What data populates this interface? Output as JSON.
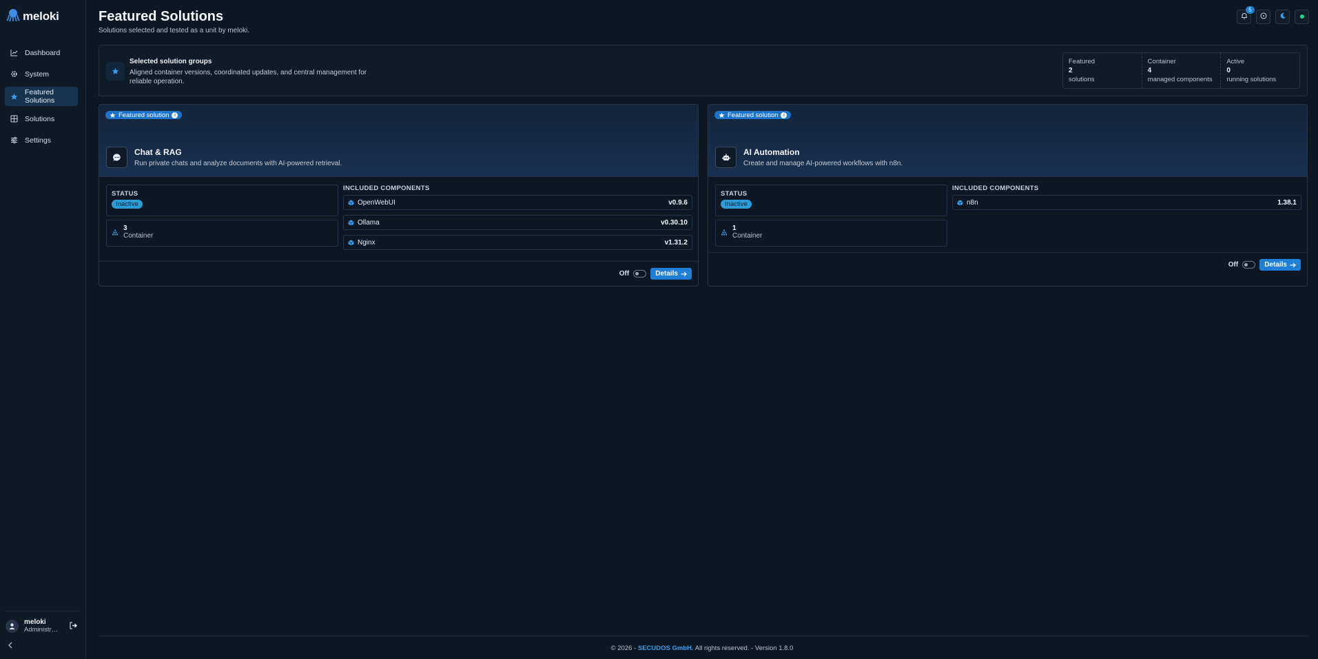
{
  "app": {
    "name": "meloki"
  },
  "sidebar": {
    "items": [
      {
        "label": "Dashboard",
        "icon": "chart-line-icon"
      },
      {
        "label": "System",
        "icon": "gear-icon"
      },
      {
        "label": "Featured Solutions",
        "icon": "star-icon",
        "active": true
      },
      {
        "label": "Solutions",
        "icon": "grid-icon"
      },
      {
        "label": "Settings",
        "icon": "sliders-icon"
      }
    ],
    "user": {
      "name": "meloki",
      "role": "Administr…"
    }
  },
  "header": {
    "title": "Featured Solutions",
    "subtitle": "Solutions selected and tested as a unit by meloki.",
    "notifications_count": "5"
  },
  "intro": {
    "title": "Selected solution groups",
    "description": "Aligned container versions, coordinated updates, and central management for reliable operation.",
    "stats": [
      {
        "label": "Featured",
        "value": "2",
        "sub": "solutions"
      },
      {
        "label": "Container",
        "value": "4",
        "sub": "managed components"
      },
      {
        "label": "Active",
        "value": "0",
        "sub": "running solutions"
      }
    ]
  },
  "solutions": [
    {
      "tag": "Featured solution",
      "title": "Chat & RAG",
      "description": "Run private chats and analyze documents with AI-powered retrieval.",
      "status_label": "STATUS",
      "status": "Inactive",
      "container_count": "3",
      "container_label": "Container",
      "components_label": "INCLUDED COMPONENTS",
      "components": [
        {
          "name": "OpenWebUI",
          "version": "v0.9.6"
        },
        {
          "name": "Ollama",
          "version": "v0.30.10"
        },
        {
          "name": "Nginx",
          "version": "v1.31.2"
        }
      ],
      "toggle_label": "Off",
      "details_label": "Details"
    },
    {
      "tag": "Featured solution",
      "title": "AI Automation",
      "description": "Create and manage AI-powered workflows with n8n.",
      "status_label": "STATUS",
      "status": "Inactive",
      "container_count": "1",
      "container_label": "Container",
      "components_label": "INCLUDED COMPONENTS",
      "components": [
        {
          "name": "n8n",
          "version": "1.38.1"
        }
      ],
      "toggle_label": "Off",
      "details_label": "Details"
    }
  ],
  "footer": {
    "prefix": "© 2026 -",
    "brand": "SECUDOS GmbH.",
    "suffix": "All rights reserved. - Version 1.8.0"
  },
  "colors": {
    "accent": "#1f7fd6",
    "background": "#0e1825",
    "status_inactive": "#2d9bd4",
    "online": "#1fd38a"
  }
}
